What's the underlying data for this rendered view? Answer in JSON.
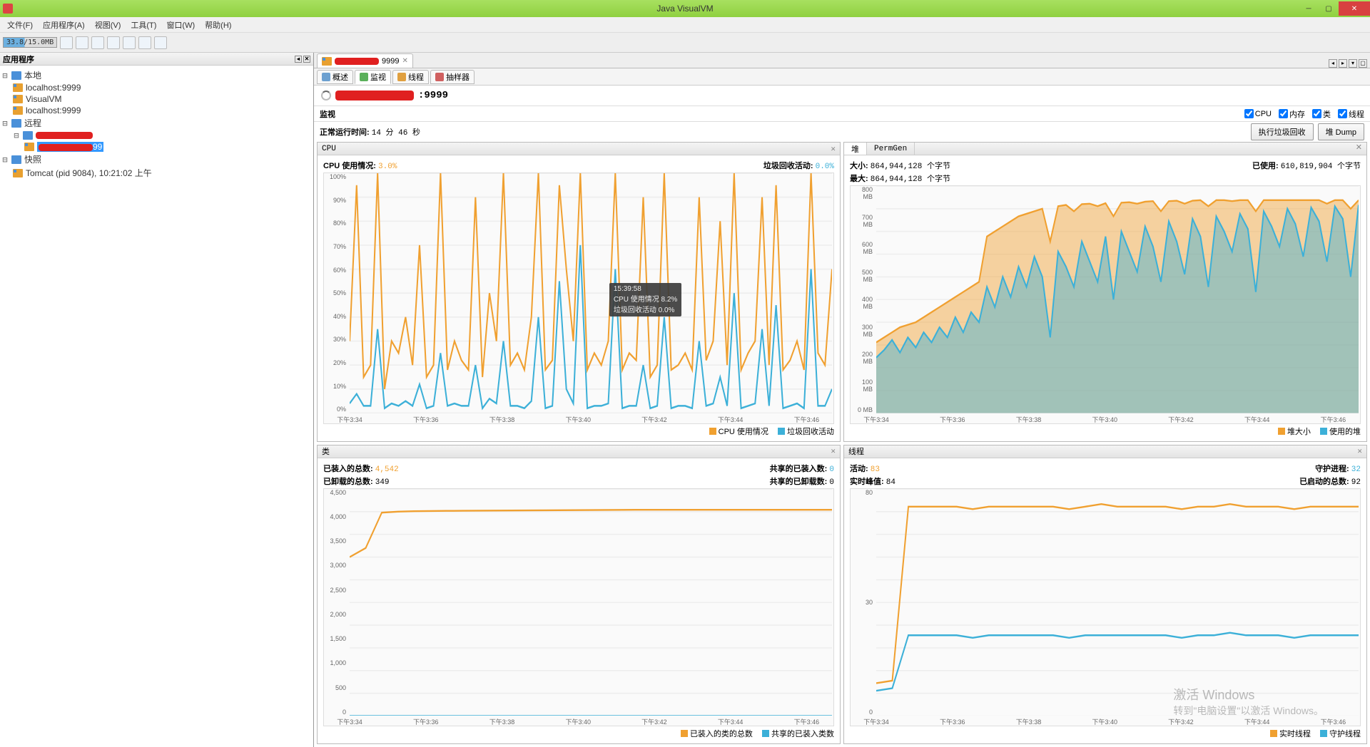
{
  "window": {
    "title": "Java VisualVM"
  },
  "menu": [
    "文件(F)",
    "应用程序(A)",
    "视图(V)",
    "工具(T)",
    "窗口(W)",
    "帮助(H)"
  ],
  "toolbar": {
    "mem": "33.8/15.0MB"
  },
  "sidebar": {
    "title": "应用程序",
    "local": "本地",
    "local_items": [
      "localhost:9999",
      "VisualVM",
      "localhost:9999"
    ],
    "remote": "远程",
    "remote_item_port": "99",
    "snapshot": "快照",
    "snapshot_item": "Tomcat (pid 9084), 10:21:02 上午"
  },
  "tab": {
    "port": "9999"
  },
  "subtabs": [
    "概述",
    "监视",
    "线程",
    "抽样器"
  ],
  "page": {
    "port_label": "9999",
    "monitor_label": "监视"
  },
  "checks": [
    "CPU",
    "内存",
    "类",
    "线程"
  ],
  "uptime": {
    "label": "正常运行时间:",
    "value": "14 分 46 秒"
  },
  "buttons": {
    "gc": "执行垃圾回收",
    "heapdump": "堆 Dump"
  },
  "cpu": {
    "title": "CPU",
    "usage_label": "CPU 使用情况:",
    "usage_val": "3.0%",
    "gc_label": "垃圾回收活动:",
    "gc_val": "0.0%",
    "legend1": "CPU 使用情况",
    "legend2": "垃圾回收活动",
    "tooltip": {
      "time": "15:39:58",
      "l1": "CPU 使用情况   8.2%",
      "l2": "垃圾回收活动   0.0%"
    }
  },
  "heap": {
    "tab1": "堆",
    "tab2": "PermGen",
    "size_label": "大小:",
    "size_val": "864,944,128 个字节",
    "used_label": "已使用:",
    "used_val": "610,819,904 个字节",
    "max_label": "最大:",
    "max_val": "864,944,128 个字节",
    "legend1": "堆大小",
    "legend2": "使用的堆"
  },
  "classes": {
    "title": "类",
    "loaded_label": "已装入的总数:",
    "loaded_val": "4,542",
    "shared_loaded_label": "共享的已装入数:",
    "shared_loaded_val": "0",
    "unloaded_label": "已卸载的总数:",
    "unloaded_val": "349",
    "shared_unloaded_label": "共享的已卸载数:",
    "shared_unloaded_val": "0",
    "legend1": "已装入的类的总数",
    "legend2": "共享的已装入类数"
  },
  "threads": {
    "title": "线程",
    "live_label": "活动:",
    "live_val": "83",
    "daemon_label": "守护进程:",
    "daemon_val": "32",
    "peak_label": "实时峰值:",
    "peak_val": "84",
    "started_label": "已启动的总数:",
    "started_val": "92",
    "legend1": "实时线程",
    "legend2": "守护线程"
  },
  "xticks": [
    "下午3:34",
    "下午3:36",
    "下午3:38",
    "下午3:40",
    "下午3:42",
    "下午3:44",
    "下午3:46"
  ],
  "watermark": {
    "l1": "激活 Windows",
    "l2": "转到\"电脑设置\"以激活 Windows。"
  },
  "chart_data": [
    {
      "type": "line",
      "title": "CPU",
      "xlabel": "",
      "ylabel": "%",
      "ylim": [
        0,
        100
      ],
      "x": [
        "下午3:34",
        "下午3:36",
        "下午3:38",
        "下午3:40",
        "下午3:42",
        "下午3:44",
        "下午3:46"
      ],
      "series": [
        {
          "name": "CPU 使用情况",
          "color": "#f0a030",
          "values": [
            30,
            95,
            15,
            20,
            100,
            10,
            30,
            25,
            40,
            20,
            70,
            15,
            20,
            100,
            18,
            30,
            22,
            18,
            90,
            15,
            50,
            30,
            100,
            20,
            25,
            18,
            40,
            100,
            18,
            22,
            95,
            60,
            30,
            100,
            18,
            25,
            20,
            30,
            100,
            18,
            25,
            22,
            90,
            15,
            20,
            100,
            18,
            20,
            25,
            18,
            90,
            22,
            30,
            80,
            20,
            100,
            18,
            25,
            30,
            90,
            20,
            95,
            18,
            22,
            30,
            18,
            100,
            25,
            20,
            60
          ]
        },
        {
          "name": "垃圾回收活动",
          "color": "#3cb0d8",
          "values": [
            4,
            8,
            3,
            3,
            35,
            2,
            4,
            3,
            5,
            3,
            12,
            2,
            3,
            25,
            3,
            4,
            3,
            3,
            20,
            2,
            6,
            4,
            30,
            3,
            3,
            2,
            5,
            40,
            2,
            3,
            55,
            10,
            4,
            70,
            2,
            3,
            3,
            4,
            60,
            2,
            3,
            3,
            20,
            2,
            3,
            40,
            2,
            3,
            3,
            2,
            30,
            3,
            4,
            15,
            3,
            50,
            2,
            3,
            4,
            35,
            3,
            45,
            2,
            3,
            4,
            2,
            60,
            3,
            3,
            10
          ]
        }
      ]
    },
    {
      "type": "area",
      "title": "堆",
      "xlabel": "",
      "ylabel": "MB",
      "ylim": [
        0,
        900
      ],
      "x": [
        "下午3:34",
        "下午3:36",
        "下午3:38",
        "下午3:40",
        "下午3:42",
        "下午3:44",
        "下午3:46"
      ],
      "series": [
        {
          "name": "堆大小",
          "color": "#f0a030",
          "values": [
            280,
            300,
            320,
            340,
            350,
            360,
            380,
            400,
            420,
            440,
            460,
            480,
            500,
            520,
            700,
            720,
            740,
            760,
            780,
            790,
            800,
            810,
            680,
            820,
            825,
            800,
            828,
            830,
            820,
            832,
            780,
            834,
            836,
            830,
            838,
            840,
            800,
            840,
            842,
            830,
            842,
            844,
            820,
            844,
            844,
            840,
            844,
            844,
            800,
            844,
            844,
            844,
            844,
            844,
            844,
            844,
            844,
            830,
            844,
            844,
            810,
            844
          ]
        },
        {
          "name": "使用的堆",
          "color": "#3cb0d8",
          "values": [
            220,
            250,
            290,
            240,
            300,
            260,
            320,
            280,
            340,
            300,
            380,
            320,
            400,
            360,
            500,
            420,
            540,
            460,
            580,
            500,
            620,
            540,
            300,
            640,
            580,
            500,
            680,
            600,
            520,
            700,
            450,
            720,
            640,
            560,
            740,
            660,
            520,
            760,
            680,
            550,
            770,
            700,
            500,
            780,
            720,
            640,
            790,
            730,
            480,
            800,
            740,
            660,
            810,
            750,
            620,
            815,
            760,
            600,
            820,
            770,
            540,
            825
          ]
        }
      ]
    },
    {
      "type": "line",
      "title": "类",
      "xlabel": "",
      "ylabel": "",
      "ylim": [
        0,
        5000
      ],
      "x": [
        "下午3:34",
        "下午3:36",
        "下午3:38",
        "下午3:40",
        "下午3:42",
        "下午3:44",
        "下午3:46"
      ],
      "series": [
        {
          "name": "已装入的类的总数",
          "color": "#f0a030",
          "values": [
            3500,
            3700,
            4480,
            4500,
            4510,
            4515,
            4518,
            4520,
            4522,
            4524,
            4526,
            4528,
            4530,
            4532,
            4534,
            4536,
            4538,
            4540,
            4542,
            4542,
            4542,
            4542,
            4542,
            4542,
            4542,
            4542,
            4542,
            4542,
            4542,
            4542,
            4542
          ]
        },
        {
          "name": "共享的已装入类数",
          "color": "#3cb0d8",
          "values": [
            0,
            0,
            0,
            0,
            0,
            0,
            0,
            0,
            0,
            0,
            0,
            0,
            0,
            0,
            0,
            0,
            0,
            0,
            0,
            0,
            0,
            0,
            0,
            0,
            0,
            0,
            0,
            0,
            0,
            0,
            0
          ]
        }
      ]
    },
    {
      "type": "line",
      "title": "线程",
      "xlabel": "",
      "ylabel": "",
      "ylim": [
        0,
        90
      ],
      "x": [
        "下午3:34",
        "下午3:36",
        "下午3:38",
        "下午3:40",
        "下午3:42",
        "下午3:44",
        "下午3:46"
      ],
      "series": [
        {
          "name": "实时线程",
          "color": "#f0a030",
          "values": [
            13,
            14,
            83,
            83,
            83,
            83,
            82,
            83,
            83,
            83,
            83,
            83,
            82,
            83,
            84,
            83,
            83,
            83,
            83,
            82,
            83,
            83,
            84,
            83,
            83,
            83,
            82,
            83,
            83,
            83,
            83
          ]
        },
        {
          "name": "守护线程",
          "color": "#3cb0d8",
          "values": [
            10,
            11,
            32,
            32,
            32,
            32,
            31,
            32,
            32,
            32,
            32,
            32,
            31,
            32,
            32,
            32,
            32,
            32,
            32,
            31,
            32,
            32,
            33,
            32,
            32,
            32,
            31,
            32,
            32,
            32,
            32
          ]
        }
      ]
    }
  ]
}
